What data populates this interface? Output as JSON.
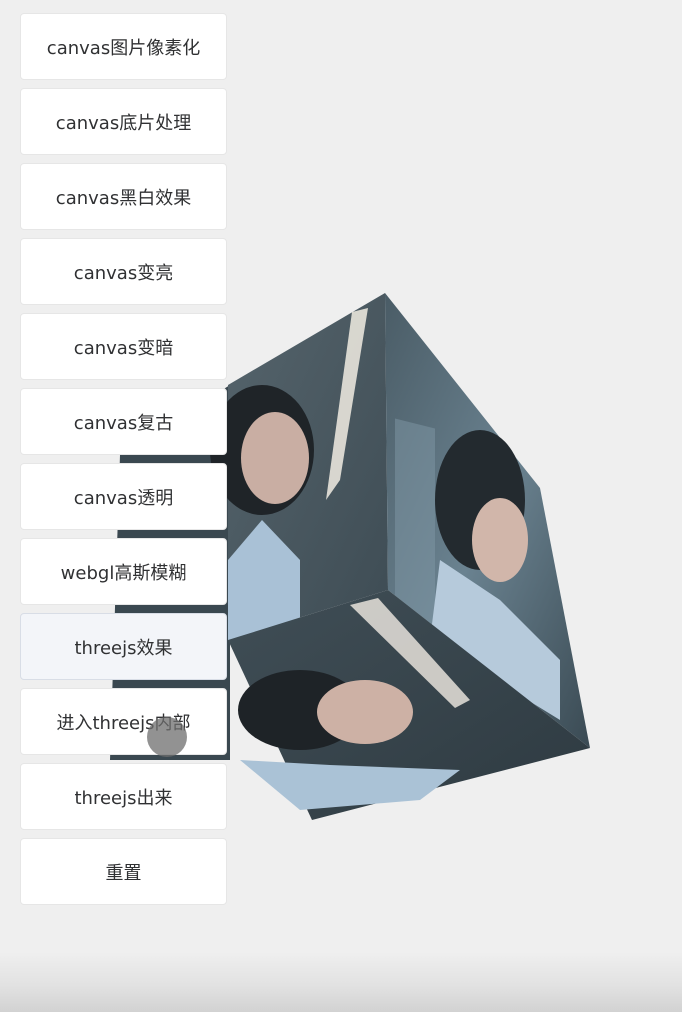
{
  "buttons": [
    {
      "label": "canvas图片像素化"
    },
    {
      "label": "canvas底片处理"
    },
    {
      "label": "canvas黑白效果"
    },
    {
      "label": "canvas变亮"
    },
    {
      "label": "canvas变暗"
    },
    {
      "label": "canvas复古"
    },
    {
      "label": "canvas透明"
    },
    {
      "label": "webgl高斯模糊"
    },
    {
      "label": "threejs效果",
      "active": true
    },
    {
      "label": "进入threejs内部"
    },
    {
      "label": "threejs出来"
    },
    {
      "label": "重置"
    }
  ],
  "cube": {
    "description_icon": "photo-cube",
    "face_colors": {
      "top": "#4b5a62",
      "left": "#3d4a52",
      "right": "#556872",
      "accent": "#9fb6c8"
    }
  }
}
